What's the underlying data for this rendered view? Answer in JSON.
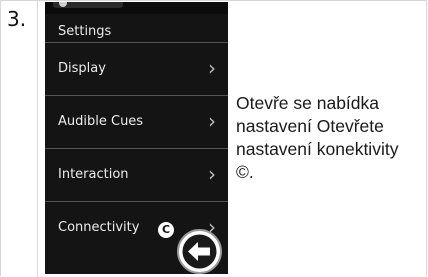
{
  "step": {
    "number": "3."
  },
  "device": {
    "title": "Settings",
    "menu": [
      {
        "label": "Display",
        "chevron": "›"
      },
      {
        "label": "Audible Cues",
        "chevron": "›"
      },
      {
        "label": "Interaction",
        "chevron": "›"
      },
      {
        "label": "Connectivity",
        "chevron": "›"
      }
    ],
    "callout_marker": "C",
    "back_icon": "left-arrow-circle-icon"
  },
  "description": "Otevře se nabídka nastavení Otevřete nastavení konektivity ©."
}
